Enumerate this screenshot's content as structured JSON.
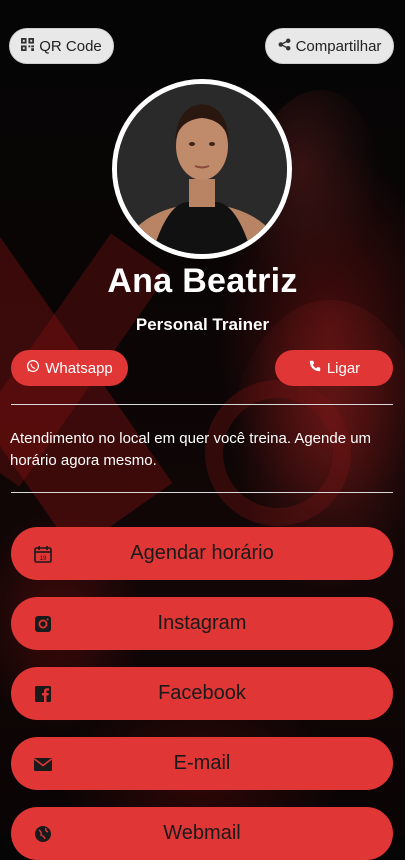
{
  "header": {
    "qr_label": "QR Code",
    "share_label": "Compartilhar"
  },
  "profile": {
    "name": "Ana Beatriz",
    "role": "Personal Trainer",
    "description": "Atendimento no local em quer você treina. Agende um horário agora mesmo."
  },
  "contact": {
    "whatsapp_label": "Whatsapp",
    "call_label": "Ligar"
  },
  "links": [
    {
      "label": "Agendar horário",
      "icon": "calendar-icon"
    },
    {
      "label": "Instagram",
      "icon": "instagram-icon"
    },
    {
      "label": "Facebook",
      "icon": "facebook-icon"
    },
    {
      "label": "E-mail",
      "icon": "envelope-icon"
    },
    {
      "label": "Webmail",
      "icon": "globe-icon"
    }
  ],
  "colors": {
    "accent": "#e03636",
    "top_button_bg": "#e8e8e8",
    "background": "#050505"
  }
}
